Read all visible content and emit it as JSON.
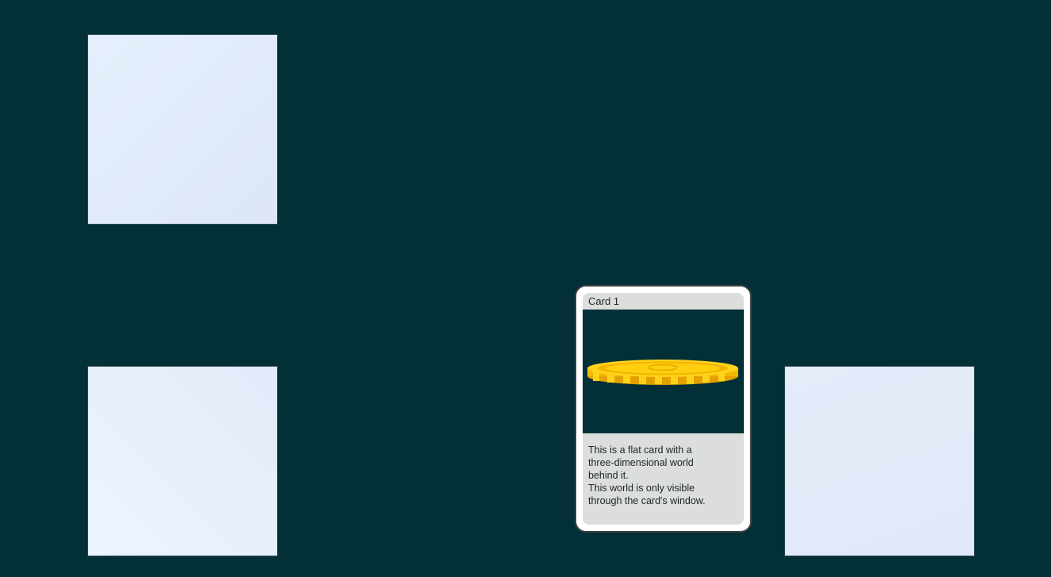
{
  "scene": {
    "background_color": "#033037",
    "tiles": [
      {
        "name": "tile-top-left",
        "color": "#e2ebfa"
      },
      {
        "name": "tile-bottom-left",
        "color": "#e8effc"
      },
      {
        "name": "tile-bottom-right",
        "color": "#e3e9f8"
      }
    ]
  },
  "card": {
    "title": "Card 1",
    "window_object": "gold-coin-icon",
    "description_lines": [
      "This is a flat card with a",
      "three-dimensional world",
      "behind it.",
      "This world is only visible",
      "through the card's window."
    ],
    "colors": {
      "border": "#3a3f42",
      "panel": "#dcdedd",
      "window": "#033037",
      "coin": "#ffcc00"
    }
  }
}
